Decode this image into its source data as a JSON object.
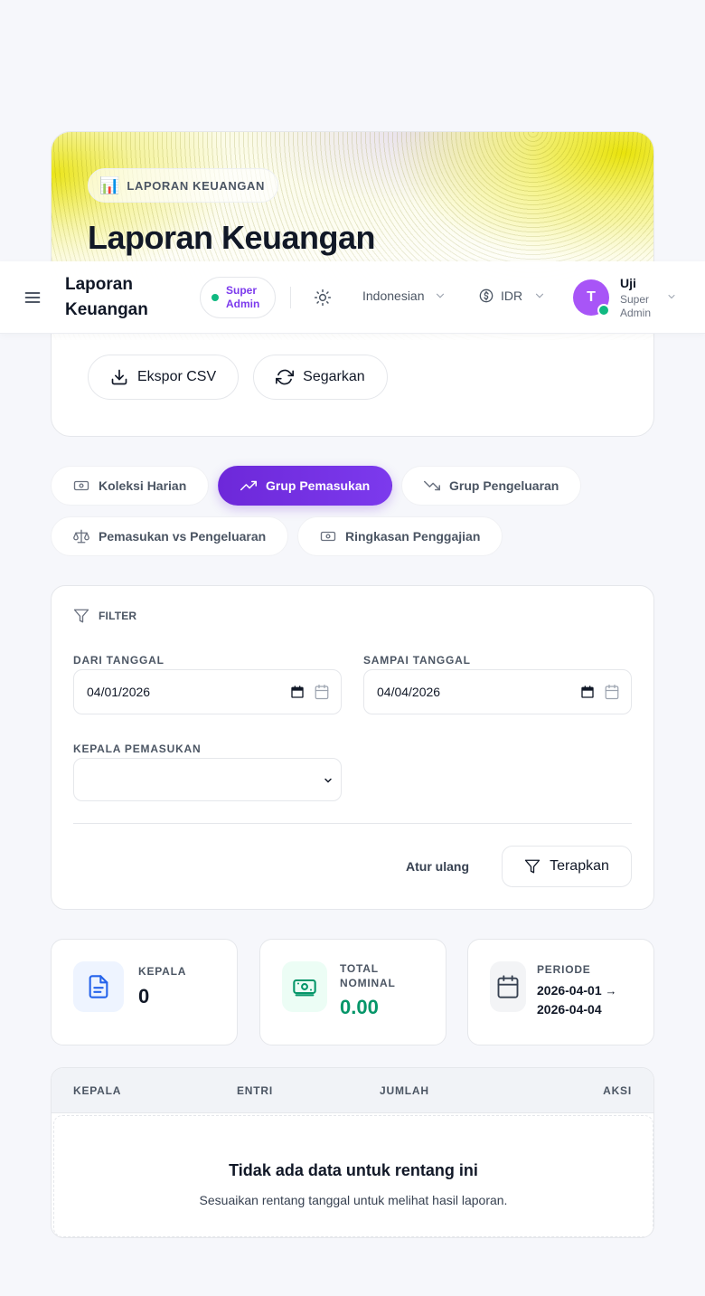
{
  "hero": {
    "badge_icon": "bar-chart-emoji",
    "badge_emoji": "📊",
    "badge_label": "LAPORAN KEUANGAN",
    "title": "Laporan Keuangan",
    "export_label": "Ekspor CSV",
    "refresh_label": "Segarkan"
  },
  "topbar": {
    "title": "Laporan Keuangan",
    "role_badge": "Super Admin",
    "language": "Indonesian",
    "currency": "IDR",
    "avatar_initial": "T",
    "user_name": "Uji",
    "user_role": "Super Admin"
  },
  "tabs": [
    {
      "label": "Koleksi Harian",
      "icon": "banknote-icon",
      "active": false
    },
    {
      "label": "Grup Pemasukan",
      "icon": "trending-up-icon",
      "active": true
    },
    {
      "label": "Grup Pengeluaran",
      "icon": "trending-down-icon",
      "active": false
    },
    {
      "label": "Pemasukan vs Pengeluaran",
      "icon": "scale-icon",
      "active": false
    },
    {
      "label": "Ringkasan Penggajian",
      "icon": "banknote-icon",
      "active": false
    }
  ],
  "filter": {
    "heading": "FILTER",
    "from_label": "DARI TANGGAL",
    "from_value": "04/01/2026",
    "to_label": "SAMPAI TANGGAL",
    "to_value": "04/04/2026",
    "head_label": "KEPALA PEMASUKAN",
    "head_value": "",
    "reset_label": "Atur ulang",
    "apply_label": "Terapkan"
  },
  "stats": {
    "heads_label": "KEPALA",
    "heads_value": "0",
    "total_label": "TOTAL NOMINAL",
    "total_value": "0.00",
    "period_label": "PERIODE",
    "period_start": "2026-04-01",
    "period_arrow": "→",
    "period_end": "2026-04-04"
  },
  "table": {
    "columns": [
      "KEPALA",
      "ENTRI",
      "JUMLAH",
      "AKSI"
    ],
    "empty_title": "Tidak ada data untuk rentang ini",
    "empty_subtitle": "Sesuaikan rentang tanggal untuk melihat hasil laporan."
  },
  "colors": {
    "accent": "#6d28d9",
    "success": "#10b981",
    "avatar": "#a855f7",
    "total_value": "#059669"
  }
}
